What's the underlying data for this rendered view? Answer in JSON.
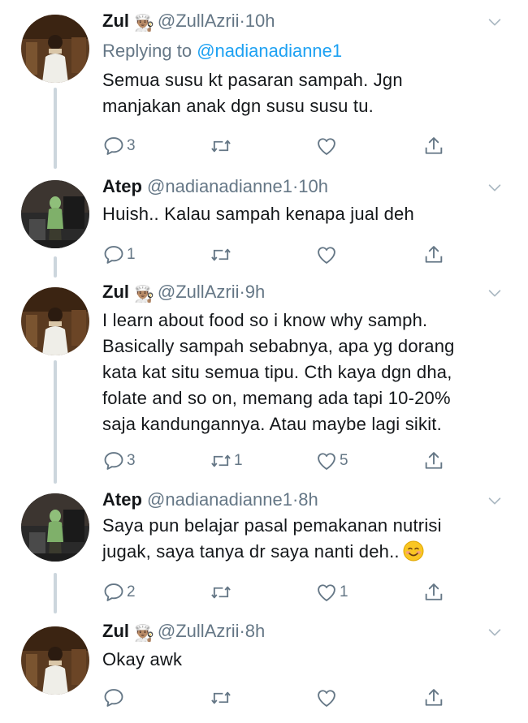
{
  "tweets": [
    {
      "name": "Zul",
      "name_emoji": "👨🏽‍🍳",
      "handle": "@ZullAzrii",
      "dot": "·",
      "time": "10h",
      "replying_prefix": "Replying to",
      "replying_to": "@nadianadianne1",
      "text": "Semua susu kt pasaran sampah. Jgn\nmanjakan anak dgn susu susu tu.",
      "reply_count": "3",
      "retweet_count": "",
      "like_count": ""
    },
    {
      "name": "Atep",
      "name_emoji": "",
      "handle": "@nadianadianne1",
      "dot": "·",
      "time": "10h",
      "text": "Huish.. Kalau sampah kenapa jual deh",
      "reply_count": "1",
      "retweet_count": "",
      "like_count": ""
    },
    {
      "name": "Zul",
      "name_emoji": "👨🏽‍🍳",
      "handle": "@ZullAzrii",
      "dot": "·",
      "time": "9h",
      "text": "I learn about food so i know why samph.\nBasically sampah sebabnya, apa yg dorang\nkata kat situ semua tipu. Cth kaya dgn dha,\nfolate and so on, memang ada tapi 10-20%\nsaja kandungannya. Atau maybe lagi sikit.",
      "reply_count": "3",
      "retweet_count": "1",
      "like_count": "5"
    },
    {
      "name": "Atep",
      "name_emoji": "",
      "handle": "@nadianadianne1",
      "dot": "·",
      "time": "8h",
      "text": "Saya pun belajar pasal pemakanan nutrisi\njugak,  saya tanya dr saya nanti deh..",
      "text_emoji": "😊",
      "reply_count": "2",
      "retweet_count": "",
      "like_count": "1"
    },
    {
      "name": "Zul",
      "name_emoji": "👨🏽‍🍳",
      "handle": "@ZullAzrii",
      "dot": "·",
      "time": "8h",
      "text": "Okay awk",
      "reply_count": "",
      "retweet_count": "",
      "like_count": ""
    }
  ],
  "icons": {
    "reply": "reply-icon",
    "retweet": "retweet-icon",
    "like": "heart-icon",
    "share": "share-icon",
    "caret": "chevron-down-icon"
  },
  "colors": {
    "link": "#1da1f2",
    "secondary": "#657786",
    "thread_line": "#ccd6dd"
  }
}
